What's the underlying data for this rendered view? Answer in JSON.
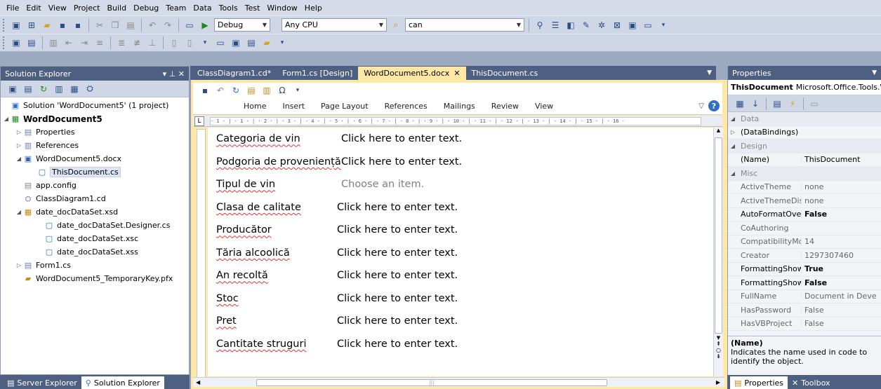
{
  "menu": [
    "File",
    "Edit",
    "View",
    "Project",
    "Build",
    "Debug",
    "Team",
    "Data",
    "Tools",
    "Test",
    "Window",
    "Help"
  ],
  "toolbar": {
    "configuration": "Debug",
    "platform": "Any CPU",
    "find": "can"
  },
  "solution_explorer": {
    "title": "Solution Explorer",
    "title_controls": "▾ ⊥ ✕",
    "items": [
      {
        "label": "Solution 'WordDocument5' (1 project)",
        "level": 0,
        "icon": "solution-icon"
      },
      {
        "label": "WordDocument5",
        "level": 0,
        "icon": "csharp-project-icon",
        "bold": true
      },
      {
        "label": "Properties",
        "level": 1,
        "icon": "properties-folder-icon"
      },
      {
        "label": "References",
        "level": 1,
        "icon": "references-icon"
      },
      {
        "label": "WordDocument5.docx",
        "level": 1,
        "icon": "word-document-icon"
      },
      {
        "label": "ThisDocument.cs",
        "level": 2,
        "icon": "csharp-file-icon",
        "selected": true
      },
      {
        "label": "app.config",
        "level": 1,
        "icon": "config-file-icon"
      },
      {
        "label": "ClassDiagram1.cd",
        "level": 1,
        "icon": "class-diagram-icon"
      },
      {
        "label": "date_docDataSet.xsd",
        "level": 1,
        "icon": "dataset-icon"
      },
      {
        "label": "date_docDataSet.Designer.cs",
        "level": 2,
        "icon": "csharp-file-icon"
      },
      {
        "label": "date_docDataSet.xsc",
        "level": 2,
        "icon": "file-icon"
      },
      {
        "label": "date_docDataSet.xss",
        "level": 2,
        "icon": "file-icon"
      },
      {
        "label": "Form1.cs",
        "level": 1,
        "icon": "form-icon"
      },
      {
        "label": "WordDocument5_TemporaryKey.pfx",
        "level": 1,
        "icon": "key-file-icon"
      }
    ]
  },
  "bottom_tabs_left": [
    "Server Explorer",
    "Solution Explorer"
  ],
  "document_tabs": [
    "ClassDiagram1.cd*",
    "Form1.cs [Design]",
    "WordDocument5.docx",
    "ThisDocument.cs"
  ],
  "ribbon_tabs": [
    "Home",
    "Insert",
    "Page Layout",
    "References",
    "Mailings",
    "Review",
    "View"
  ],
  "ruler_text": "· 1 · | · 1 · | · 2 · | · 3 · | · 4 · | · 5 · | · 6 · | · 7 · | · 8 · | · 9 · | · 10 · | · 11 · | · 12 · | · 13 · | · 14 · | · 15 · | · 16 ·",
  "document_fields": [
    {
      "label": "Categoria de vin",
      "value": "Click here to enter text.",
      "placeholder": false
    },
    {
      "label": "Podgoria de proveniență",
      "value": "Click here to enter text.",
      "placeholder": false
    },
    {
      "label": "Tipul de vin",
      "value": "Choose an item.",
      "placeholder": true
    },
    {
      "label": "Clasa de calitate",
      "value": "Click here to enter text.",
      "placeholder": false
    },
    {
      "label": "Producător",
      "value": "Click here to enter text.",
      "placeholder": false
    },
    {
      "label": "Tăria alcoolică",
      "value": "Click here to enter text.",
      "placeholder": false
    },
    {
      "label": "An recoltă",
      "value": "Click here to enter text.",
      "placeholder": false
    },
    {
      "label": "Stoc",
      "value": "Click here to enter text.",
      "placeholder": false
    },
    {
      "label": "Pret",
      "value": "Click here to enter text.",
      "placeholder": false
    },
    {
      "label": "Cantitate struguri",
      "value": "Click here to enter text.",
      "placeholder": false
    }
  ],
  "properties": {
    "title": "Properties",
    "object_name": "ThisDocument",
    "object_type": "Microsoft.Office.Tools.W",
    "rows": [
      {
        "type": "cat",
        "name": "Data"
      },
      {
        "type": "prop",
        "name": "(DataBindings)",
        "value": "",
        "expand": true,
        "active": true
      },
      {
        "type": "cat",
        "name": "Design"
      },
      {
        "type": "prop",
        "name": "(Name)",
        "value": "ThisDocument",
        "active": true
      },
      {
        "type": "cat",
        "name": "Misc"
      },
      {
        "type": "prop",
        "name": "ActiveTheme",
        "value": "none"
      },
      {
        "type": "prop",
        "name": "ActiveThemeDisp",
        "value": "none"
      },
      {
        "type": "prop",
        "name": "AutoFormatOver",
        "value": "False",
        "active": true,
        "bold": true
      },
      {
        "type": "prop",
        "name": "CoAuthoring",
        "value": ""
      },
      {
        "type": "prop",
        "name": "CompatibilityMo",
        "value": "14"
      },
      {
        "type": "prop",
        "name": "Creator",
        "value": "1297307460"
      },
      {
        "type": "prop",
        "name": "FormattingShowI",
        "value": "True",
        "active": true,
        "bold": true
      },
      {
        "type": "prop",
        "name": "FormattingShowI",
        "value": "False",
        "active": true,
        "bold": true
      },
      {
        "type": "prop",
        "name": "FullName",
        "value": "Document in Deve"
      },
      {
        "type": "prop",
        "name": "HasPassword",
        "value": "False"
      },
      {
        "type": "prop",
        "name": "HasVBProject",
        "value": "False"
      }
    ],
    "desc_title": "(Name)",
    "desc_text": "Indicates the name used in code to identify the object."
  },
  "bottom_tabs_right": [
    "Properties",
    "Toolbox"
  ],
  "colors": {
    "accent": "#4d6082",
    "active_tab": "#ffe8a6",
    "spell_underline": "#dd3333"
  }
}
